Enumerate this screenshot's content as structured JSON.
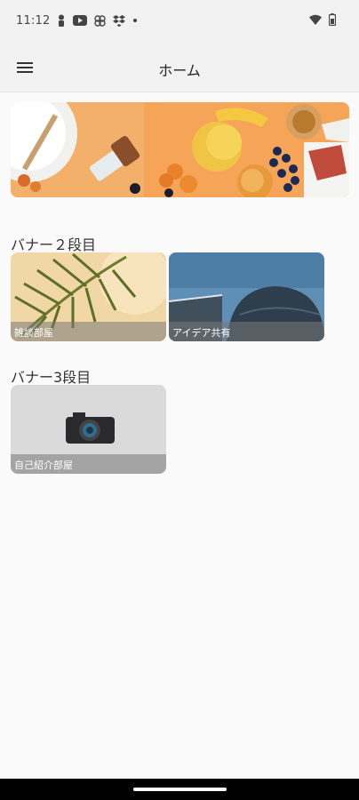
{
  "status_bar": {
    "time": "11:12",
    "left_icons": [
      "person-icon",
      "youtube-icon",
      "pinwheel-icon",
      "dropbox-icon",
      "dot-icon"
    ],
    "right_icons": [
      "wifi-icon",
      "battery-icon"
    ]
  },
  "app_bar": {
    "title": "ホーム",
    "menu_icon": "hamburger-menu-icon"
  },
  "hero_banner": {
    "image": "food-flatlay-banner"
  },
  "sections": [
    {
      "title": "バナー２段目",
      "cards": [
        {
          "label": "雑談部屋",
          "image": "palm-leaf"
        },
        {
          "label": "アイデア共有",
          "image": "dome-building"
        }
      ]
    },
    {
      "title": "バナー3段目",
      "cards": [
        {
          "label": "自己紹介部屋",
          "image": "camera"
        }
      ]
    }
  ],
  "colors": {
    "background": "#fafafa",
    "app_bar": "#f2f2f2",
    "hero_orange": "#f4a75a",
    "caption_overlay": "rgba(120,120,120,0.55)"
  }
}
